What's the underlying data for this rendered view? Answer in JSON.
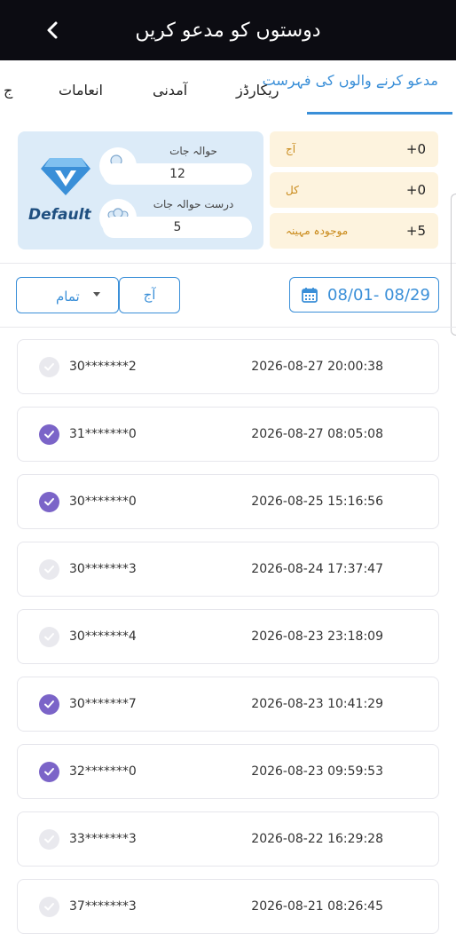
{
  "header": {
    "title": "دوستوں کو مدعو کریں"
  },
  "tabs": [
    {
      "label": "مدعو کرنے والوں کی فہرست",
      "active": true
    },
    {
      "label": "ریکارڈز",
      "active": false
    },
    {
      "label": "آمدنی",
      "active": false
    },
    {
      "label": "انعامات",
      "active": false
    },
    {
      "label": "ج",
      "active": false
    }
  ],
  "stats": {
    "level": "Default",
    "referrals_label": "حوالہ جات",
    "referrals_value": "12",
    "valid_referrals_label": "درست حوالہ جات",
    "valid_referrals_value": "5"
  },
  "income": [
    {
      "label": "آج",
      "value": "+0"
    },
    {
      "label": "کل",
      "value": "+0"
    },
    {
      "label": "موجودہ مہینہ",
      "value": "+5"
    }
  ],
  "filters": {
    "select_value": "تمام",
    "today_label": "آج",
    "date_range": "08/01- 08/29"
  },
  "records": [
    {
      "id": "30*******2",
      "time": "2026-08-27 20:00:38",
      "checked": false
    },
    {
      "id": "31*******0",
      "time": "2026-08-27 08:05:08",
      "checked": true
    },
    {
      "id": "30*******0",
      "time": "2026-08-25 15:16:56",
      "checked": true
    },
    {
      "id": "30*******3",
      "time": "2026-08-24 17:37:47",
      "checked": false
    },
    {
      "id": "30*******4",
      "time": "2026-08-23 23:18:09",
      "checked": false
    },
    {
      "id": "30*******7",
      "time": "2026-08-23 10:41:29",
      "checked": true
    },
    {
      "id": "32*******0",
      "time": "2026-08-23 09:59:53",
      "checked": true
    },
    {
      "id": "33*******3",
      "time": "2026-08-22 16:29:28",
      "checked": false
    },
    {
      "id": "37*******3",
      "time": "2026-08-21 08:26:45",
      "checked": false
    }
  ],
  "colors": {
    "accent": "#3a8fd8",
    "check_on": "#7b64c8",
    "income_label": "#c98a1a"
  }
}
